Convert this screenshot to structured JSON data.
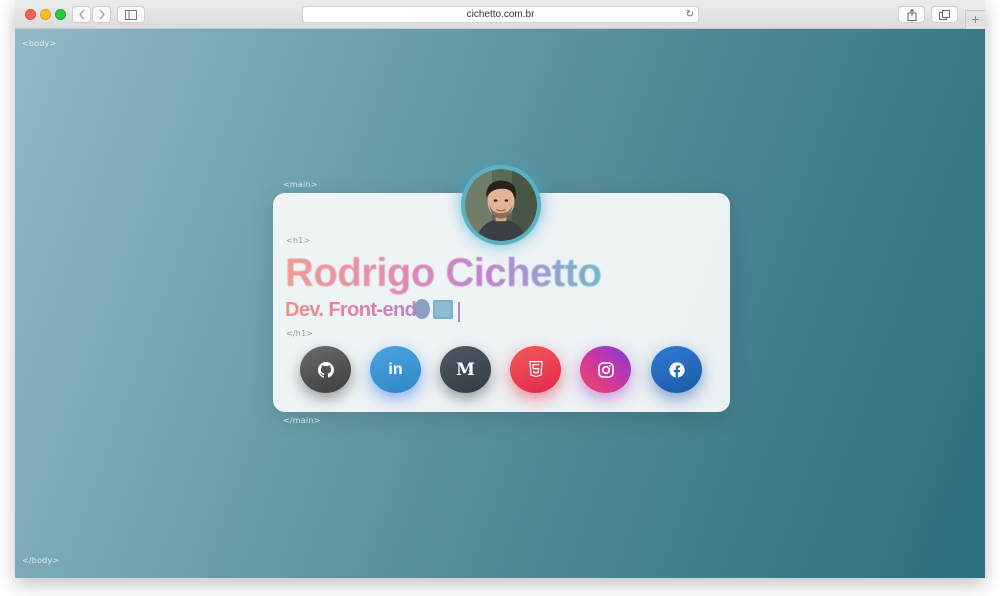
{
  "browser": {
    "url": "cichetto.com.br",
    "reload_icon": "reload-icon",
    "back_icon": "chevron-left-icon",
    "forward_icon": "chevron-right-icon",
    "sidebar_icon": "sidebar-icon",
    "share_icon": "share-icon",
    "tabs_icon": "tabs-icon",
    "new_tab_label": "+"
  },
  "page": {
    "tags": {
      "body_open": "<body>",
      "body_close": "</body>",
      "main_open": "<main>",
      "main_close": "</main>",
      "h1_open": "<h1>",
      "h1_close": "</h1>"
    },
    "name": "Rodrigo Cichetto",
    "role": "Dev. Front-end",
    "avatar": "profile-photo",
    "social": [
      {
        "network": "GitHub",
        "icon": "github-icon",
        "color": "#4f4f4f"
      },
      {
        "network": "LinkedIn",
        "icon": "linkedin-icon",
        "glyph": "in",
        "color": "#3b97d6"
      },
      {
        "network": "Medium",
        "icon": "medium-icon",
        "glyph": "M",
        "color": "#414b56"
      },
      {
        "network": "HTML5",
        "icon": "html5-icon",
        "color": "#e83e52"
      },
      {
        "network": "Instagram",
        "icon": "instagram-icon",
        "color": "#b23db0"
      },
      {
        "network": "Facebook",
        "icon": "facebook-icon",
        "color": "#2569ba"
      }
    ]
  },
  "colors": {
    "background_start": "#8fb9c6",
    "background_end": "#2d6f7f",
    "card": "#f6f8fa",
    "avatar_ring": "#5ab1c4"
  }
}
